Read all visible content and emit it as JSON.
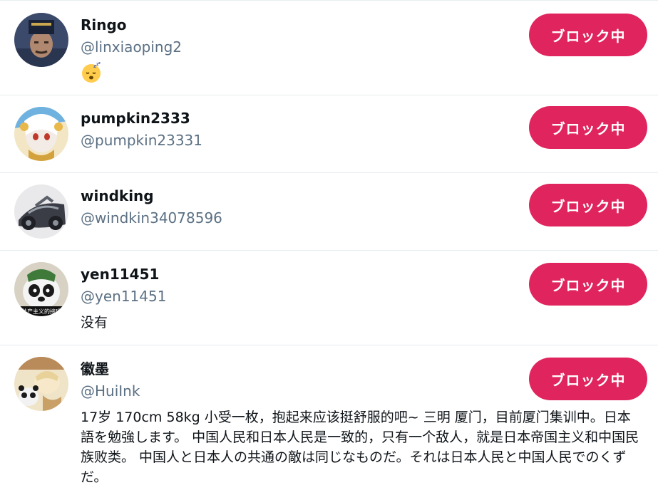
{
  "users": [
    {
      "name": "Ringo",
      "handle": "@linxiaoping2",
      "bio_icon": "sleeping-emoji-icon",
      "button": "ブロック中"
    },
    {
      "name": "pumpkin2333",
      "handle": "@pumpkin23331",
      "button": "ブロック中"
    },
    {
      "name": "windking",
      "handle": "@windkin34078596",
      "button": "ブロック中"
    },
    {
      "name": "yen11451",
      "handle": "@yen11451",
      "bio": "没有",
      "avatar_caption": "共产主义的接班",
      "button": "ブロック中"
    },
    {
      "name": "徽墨",
      "handle": "@HuiInk",
      "bio": "17岁 170cm 58kg 小受一枚，抱起来应该挺舒服的吧~ 三明 厦门，目前厦门集训中。日本語を勉強します。 中国人民和日本人民是一致的，只有一个敌人，就是日本帝国主义和中国民族败类。 中国人と日本人の共通の敵は同じなものだ。それは日本人民と中国人民でのくずだ。",
      "button": "ブロック中"
    }
  ],
  "colors": {
    "accent": "#e0245e",
    "handle": "#5b7083",
    "divider": "#e6ecf0"
  }
}
